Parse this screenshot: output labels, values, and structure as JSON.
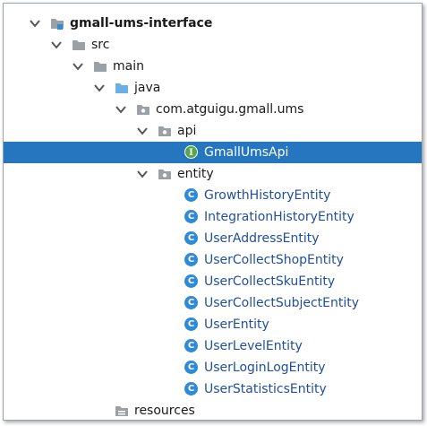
{
  "tree": {
    "root": "gmall-ums-interface",
    "src": "src",
    "main": "main",
    "java": "java",
    "package": "com.atguigu.gmall.ums",
    "api_folder": "api",
    "api_class": "GmallUmsApi",
    "entity_folder": "entity",
    "entities": [
      "GrowthHistoryEntity",
      "IntegrationHistoryEntity",
      "UserAddressEntity",
      "UserCollectShopEntity",
      "UserCollectSkuEntity",
      "UserCollectSubjectEntity",
      "UserEntity",
      "UserLevelEntity",
      "UserLoginLogEntity",
      "UserStatisticsEntity"
    ],
    "resources": "resources"
  },
  "badges": {
    "class_letter": "C",
    "interface_letter": "I"
  },
  "colors": {
    "selection": "#2675bf",
    "folder": "#9aa0a6",
    "java_folder": "#6ab0e6",
    "class_icon": "#2f8ad8",
    "interface_icon": "#57a64a",
    "class_text": "#1f4f9c"
  }
}
